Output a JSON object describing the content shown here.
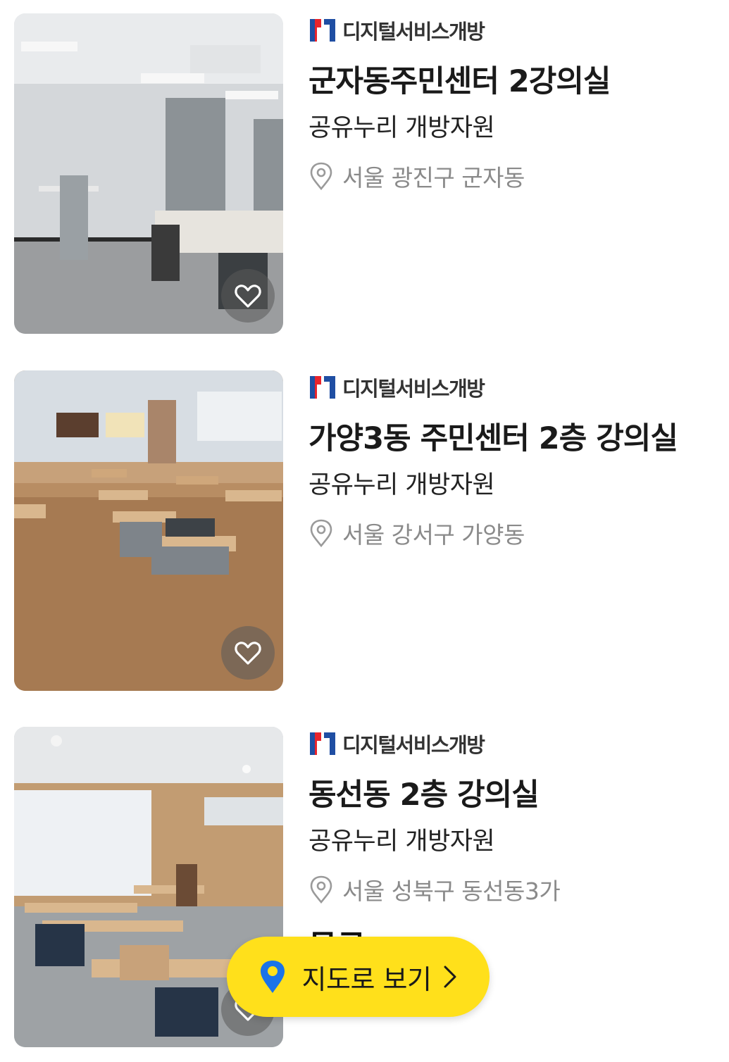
{
  "colors": {
    "brand_red": "#e8242c",
    "brand_blue": "#1f4ea3",
    "map_button_bg": "#ffe01b",
    "map_pin": "#1a73e8",
    "muted_text": "#8a8a8a"
  },
  "listings": [
    {
      "brand": "디지털서비스개방",
      "title": "군자동주민센터 2강의실",
      "provider": "공유누리 개방자원",
      "location": "서울 광진구 군자동",
      "photo_icon": "classroom-photo",
      "like_icon": "heart-outline-icon"
    },
    {
      "brand": "디지털서비스개방",
      "title": "가양3동 주민센터 2층 강의실",
      "provider": "공유누리 개방자원",
      "location": "서울 강서구 가양동",
      "photo_icon": "classroom-photo",
      "like_icon": "heart-outline-icon"
    },
    {
      "brand": "디지털서비스개방",
      "title": "동선동 2층 강의실",
      "provider": "공유누리 개방자원",
      "location": "서울 성북구 동선동3가",
      "price": "무료",
      "photo_icon": "classroom-photo",
      "like_icon": "heart-outline-icon"
    }
  ],
  "map_button": {
    "label": "지도로 보기",
    "icon": "map-pin-icon",
    "chevron": "chevron-right-icon"
  }
}
